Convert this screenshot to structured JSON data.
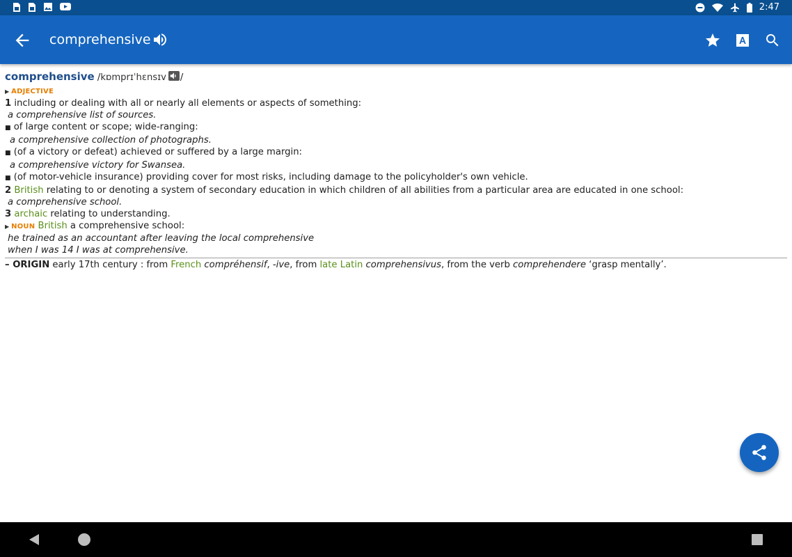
{
  "status_bar": {
    "time": "2:47",
    "left_icons": [
      "sim-card-icon",
      "sim-card-icon",
      "image-icon",
      "youtube-icon"
    ],
    "right_icons": [
      "do-not-disturb-icon",
      "wifi-icon",
      "airplane-icon",
      "battery-icon"
    ]
  },
  "app_bar": {
    "title": "comprehensive",
    "back_icon": "arrow-back-icon",
    "speaker_icon": "speaker-icon",
    "actions": [
      "star-icon",
      "font-size-icon",
      "search-icon"
    ]
  },
  "entry": {
    "headword": "comprehensive",
    "pron_open": " /",
    "pronunciation": "kɒmprɪˈhɛnsɪv",
    "pron_close": "/",
    "adjective_label": "ADJECTIVE",
    "sense1_num": "1",
    "sense1_def": " including or dealing with all or nearly all elements or aspects of something:",
    "sense1_ex": "a comprehensive list of sources.",
    "sub1_def": "of large content or scope; wide-ranging:",
    "sub1_ex": "a comprehensive collection of photographs.",
    "sub2_def": "(of a victory or defeat) achieved or suffered by a large margin:",
    "sub2_ex": "a comprehensive victory for Swansea.",
    "sub3_def": "(of motor-vehicle insurance) providing cover for most risks, including damage to the policyholder's own vehicle.",
    "sense2_num": "2",
    "sense2_region": " British",
    "sense2_def": " relating to or denoting a system of secondary education in which children of all abilities from a particular area are educated in one school:",
    "sense2_ex": "a comprehensive school.",
    "sense3_num": "3",
    "sense3_register": " archaic",
    "sense3_def": " relating to understanding.",
    "noun_label": "NOUN",
    "noun_region": " British",
    "noun_def": " a comprehensive school:",
    "noun_ex1": "he trained as an accountant after leaving the local comprehensive",
    "noun_ex2": "when I was 14 I was at comprehensive.",
    "origin_dash": "– ",
    "origin_label": "ORIGIN",
    "origin_t1": " early 17th century : from ",
    "origin_lang1": "French",
    "origin_w1": " compréhensif",
    "origin_t2": ", ",
    "origin_w2": "-ive",
    "origin_t3": ", from ",
    "origin_lang2": "late Latin",
    "origin_w3": " comprehensivus",
    "origin_t4": ", from the verb ",
    "origin_w4": "comprehendere",
    "origin_t5": " ‘grasp mentally’."
  },
  "fab": {
    "icon": "share-icon"
  },
  "nav_bar": {
    "icons": [
      "nav-back-icon",
      "nav-home-icon",
      "nav-recents-icon"
    ]
  },
  "colors": {
    "status_bar": "#0a4f8f",
    "app_bar": "#1565c0",
    "headword": "#1f4e8c",
    "part_of_speech": "#e67e00",
    "label_green": "#5a8f1b"
  }
}
